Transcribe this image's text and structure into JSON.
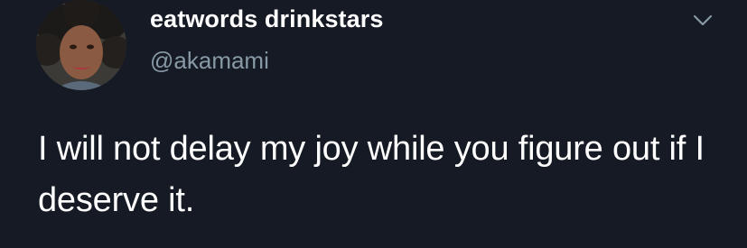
{
  "tweet": {
    "author": {
      "display_name": "eatwords drinkstars",
      "handle": "@akamami",
      "avatar_icon": "profile-photo"
    },
    "menu_icon": "chevron-down-icon",
    "text": "I will not delay my joy while you figure out if I deserve it."
  },
  "colors": {
    "background": "#151a24",
    "primary_text": "#ffffff",
    "secondary_text": "#8899a6"
  }
}
